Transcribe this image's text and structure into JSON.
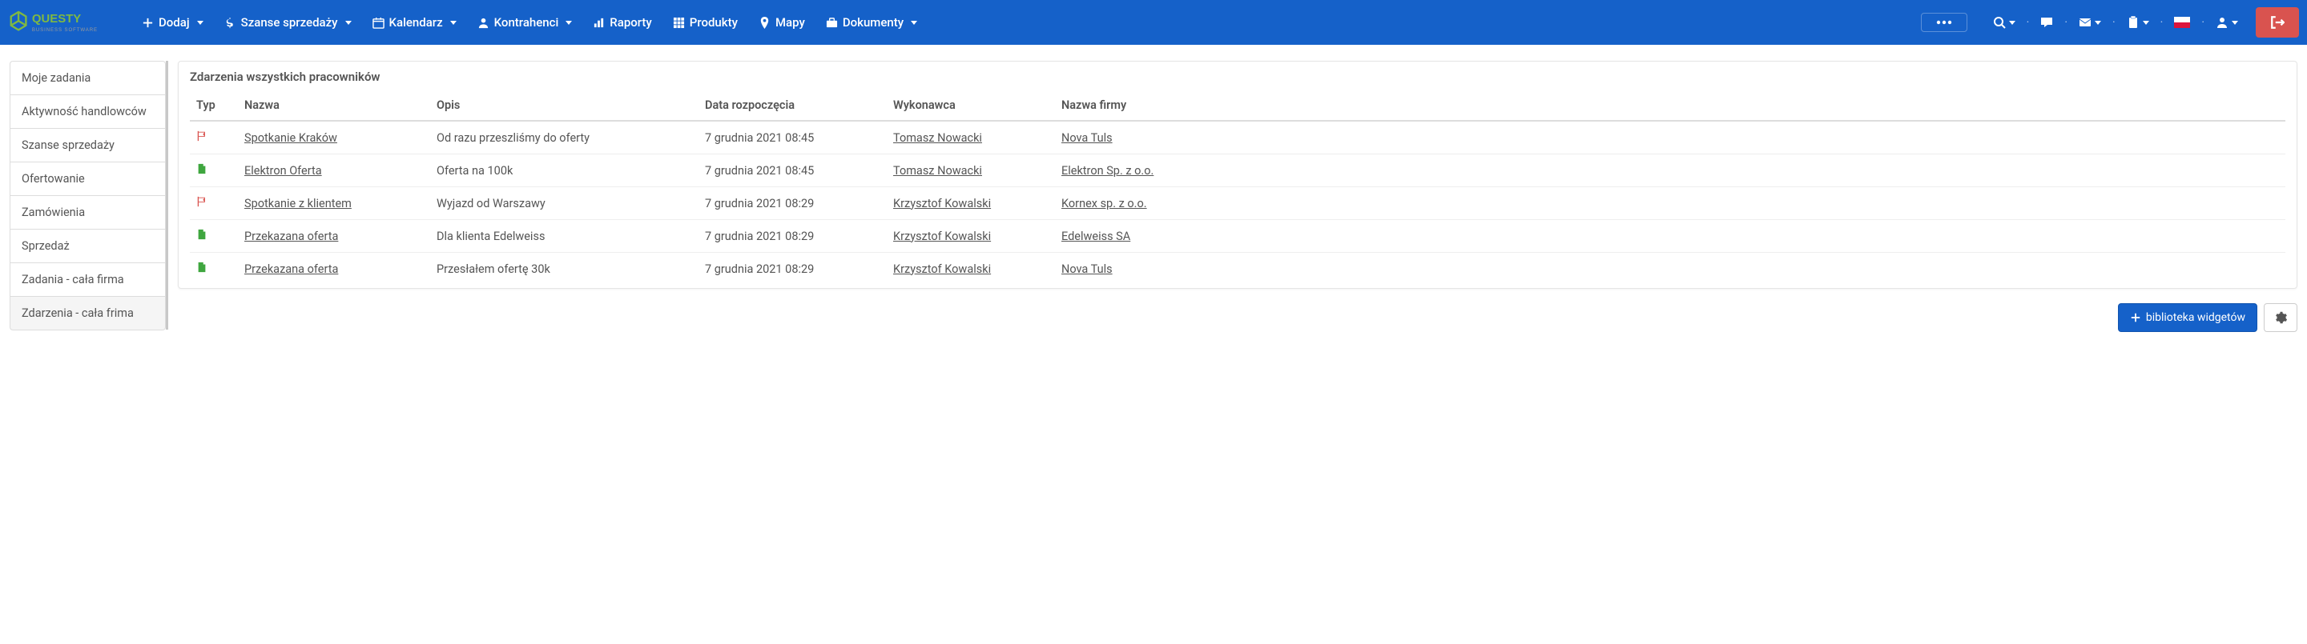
{
  "nav": {
    "add": "Dodaj",
    "opportunities": "Szanse sprzedaży",
    "calendar": "Kalendarz",
    "contractors": "Kontrahenci",
    "reports": "Raporty",
    "products": "Produkty",
    "maps": "Mapy",
    "documents": "Dokumenty"
  },
  "sidebar": {
    "items": [
      "Moje zadania",
      "Aktywność handlowców",
      "Szanse sprzedaży",
      "Ofertowanie",
      "Zamówienia",
      "Sprzedaż",
      "Zadania - cała firma",
      "Zdarzenia - cała frima"
    ]
  },
  "panel": {
    "title": "Zdarzenia wszystkich pracowników",
    "columns": {
      "type": "Typ",
      "name": "Nazwa",
      "desc": "Opis",
      "date": "Data rozpoczęcia",
      "user": "Wykonawca",
      "company": "Nazwa firmy"
    },
    "rows": [
      {
        "type": "flag",
        "name": "Spotkanie Kraków",
        "desc": "Od razu przeszliśmy do oferty",
        "date": "7 grudnia 2021 08:45",
        "user": "Tomasz Nowacki",
        "company": "Nova Tuls"
      },
      {
        "type": "file",
        "name": "Elektron Oferta",
        "desc": "Oferta na 100k",
        "date": "7 grudnia 2021 08:45",
        "user": "Tomasz Nowacki",
        "company": "Elektron Sp. z o.o."
      },
      {
        "type": "flag",
        "name": "Spotkanie z klientem",
        "desc": "Wyjazd od Warszawy",
        "date": "7 grudnia 2021 08:29",
        "user": "Krzysztof Kowalski",
        "company": "Kornex sp. z o.o."
      },
      {
        "type": "file",
        "name": "Przekazana oferta",
        "desc": "Dla klienta Edelweiss",
        "date": "7 grudnia 2021 08:29",
        "user": "Krzysztof Kowalski",
        "company": "Edelweiss SA"
      },
      {
        "type": "file",
        "name": "Przekazana oferta",
        "desc": "Przesłałem ofertę 30k",
        "date": "7 grudnia 2021 08:29",
        "user": "Krzysztof Kowalski",
        "company": "Nova Tuls"
      }
    ]
  },
  "footer": {
    "widget_library": "biblioteka widgetów"
  }
}
